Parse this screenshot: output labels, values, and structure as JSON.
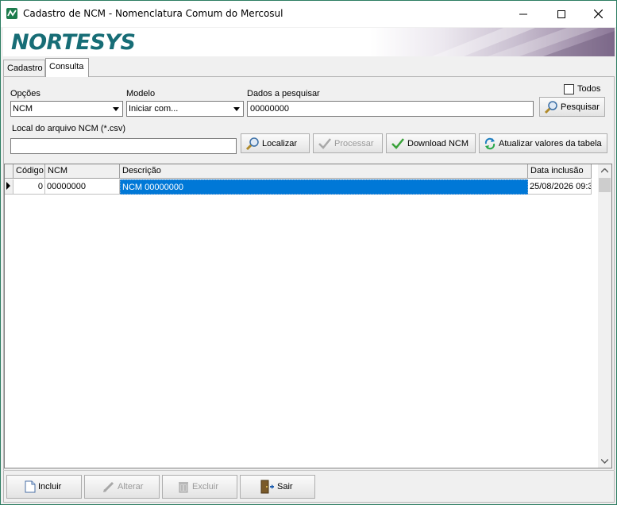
{
  "window": {
    "title": "Cadastro de NCM - Nomenclatura Comum do Mercosul",
    "minimize_icon": "minimize-icon",
    "maximize_icon": "maximize-icon",
    "close_icon": "close-icon"
  },
  "banner": {
    "logo": "NORTESYS"
  },
  "tabs": [
    {
      "label": "Cadastro",
      "active": false
    },
    {
      "label": "Consulta",
      "active": true
    }
  ],
  "form": {
    "opcoes_label": "Opções",
    "opcoes_value": "NCM",
    "modelo_label": "Modelo",
    "modelo_value": "Iniciar com...",
    "dados_label": "Dados a pesquisar",
    "dados_value": "00000000",
    "todos_label": "Todos",
    "todos_checked": false,
    "pesquisar_label": "Pesquisar",
    "local_label": "Local do arquivo NCM (*.csv)",
    "local_value": "",
    "localizar_label": "Localizar",
    "processar_label": "Processar",
    "download_label": "Download NCM",
    "atualizar_label": "Atualizar valores da tabela"
  },
  "grid": {
    "columns": [
      "Código",
      "NCM",
      "Descrição",
      "Data inclusão"
    ],
    "rows": [
      {
        "codigo": "0",
        "ncm": "00000000",
        "descricao": "NCM 00000000",
        "data": "25/08/2026 09:3"
      }
    ]
  },
  "bottom": {
    "incluir_label": "Incluir",
    "alterar_label": "Alterar",
    "excluir_label": "Excluir",
    "sair_label": "Sair"
  },
  "colors": {
    "selection": "#0078d7",
    "brand": "#176d76"
  }
}
